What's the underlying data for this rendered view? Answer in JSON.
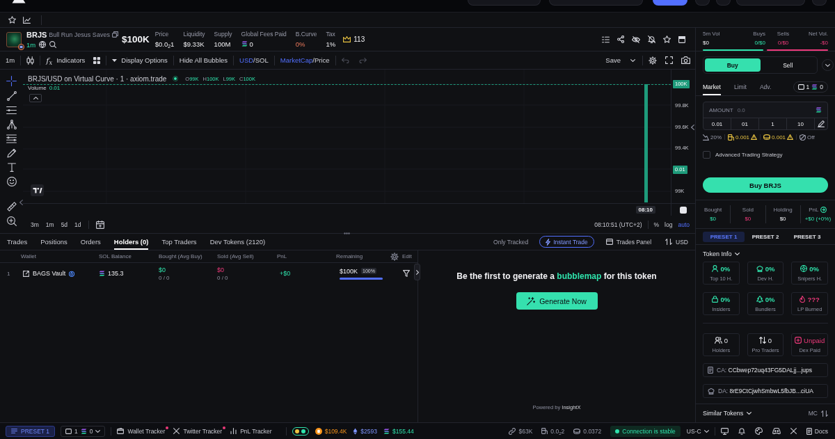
{
  "token": {
    "symbol": "BRJS",
    "name": "Bull Run Jesus Saves",
    "age": "1m",
    "market_cap": "$100K",
    "stats": [
      {
        "label": "Price",
        "value": "$0.0$_{2}$1",
        "kind": "plain"
      },
      {
        "label": "Liquidity",
        "value": "$9.33K",
        "kind": "plain"
      },
      {
        "label": "Supply",
        "value": "100M",
        "kind": "plain"
      },
      {
        "label": "Global Fees Paid",
        "value": "0",
        "kind": "sol"
      },
      {
        "label": "B.Curve",
        "value": "0%",
        "kind": "alert"
      },
      {
        "label": "Tax",
        "value": "1%",
        "kind": "plain"
      }
    ],
    "crown_count": "113"
  },
  "chart_toolbar": {
    "interval": "1m",
    "indicators": {
      "icon": "f$_{x}$",
      "label": "Indicators"
    },
    "display_options": "Display Options",
    "hide_bubbles": "Hide All Bubbles",
    "toggles": [
      {
        "options": [
          {
            "label": "USD",
            "selected": true
          },
          {
            "label": "SOL",
            "selected": false
          }
        ],
        "separator": "/"
      },
      {
        "options": [
          {
            "label": "MarketCap",
            "selected": true
          },
          {
            "label": "Price",
            "selected": false
          }
        ],
        "separator": "/"
      }
    ],
    "save": "Save"
  },
  "chart": {
    "title": "BRJS/USD on Virtual Curve · 1 · axiom.trade",
    "ohlc": [
      {
        "key": "O",
        "value": "99K"
      },
      {
        "key": "H",
        "value": "100K"
      },
      {
        "key": "L",
        "value": "99K"
      },
      {
        "key": "C",
        "value": "100K"
      }
    ],
    "volume": {
      "label": "Volume",
      "value": "0.01"
    },
    "axis_labels": [
      {
        "text": "100K",
        "kind": "marker"
      },
      {
        "text": "99.8K",
        "kind": "tick"
      },
      {
        "text": "99.6K",
        "kind": "tick"
      },
      {
        "text": "99.4K",
        "kind": "tick"
      },
      {
        "text": "0.01",
        "kind": "marker"
      },
      {
        "text": "99K",
        "kind": "tick"
      }
    ],
    "time_label": "08:10",
    "ranges": [
      "3m",
      "1m",
      "5d",
      "1d"
    ],
    "clock": "08:10:51 (UTC+2)",
    "scales": [
      {
        "label": "%",
        "selected": false
      },
      {
        "label": "log",
        "selected": false
      },
      {
        "label": "auto",
        "selected": true
      }
    ]
  },
  "bottom_panel": {
    "tabs": [
      {
        "label": "Trades",
        "selected": false
      },
      {
        "label": "Positions",
        "selected": false
      },
      {
        "label": "Orders",
        "selected": false
      },
      {
        "label": "Holders (0)",
        "selected": true
      },
      {
        "label": "Top Traders",
        "selected": false
      },
      {
        "label": "Dev Tokens (2120)",
        "selected": false
      }
    ],
    "only_tracked": "Only Tracked",
    "instant_trade": {
      "label": "Instant Trade",
      "on": true
    },
    "trades_panel": "Trades Panel",
    "currency": "USD",
    "holders": {
      "columns": [
        "Wallet",
        "SOL Balance",
        "Bought (Avg Buy)",
        "Sold (Avg Sell)",
        "PnL",
        "Remaining"
      ],
      "edit": "Edit",
      "rows": [
        {
          "rank": "1",
          "wallet": "BAGS Vault",
          "sol_balance": "135.3",
          "bought": "$0",
          "bought_count": "0 / 0",
          "sold": "$0",
          "sold_count": "0 / 0",
          "pnl": "+$0",
          "remaining": "$100K",
          "remaining_share": "100%",
          "level": 1
        }
      ]
    },
    "bubblemap": {
      "message": "Be the first to generate a **bubblemap** for this token",
      "button": "Generate Now",
      "powered_by": "Powered by",
      "provider": "InsightX"
    }
  },
  "side_panel": {
    "volume": [
      {
        "label": "5m Vol",
        "value": "$0",
        "kind": "neutral"
      },
      {
        "label": "Buys",
        "value": "0/$0",
        "kind": "buy"
      },
      {
        "label": "Sells",
        "value": "0/$0",
        "kind": "sell"
      },
      {
        "label": "Net Vol.",
        "value": "-$0",
        "kind": "sell"
      }
    ],
    "sides": [
      {
        "label": "Buy",
        "selected": true
      },
      {
        "label": "Sell",
        "selected": false
      }
    ],
    "order_types": [
      {
        "label": "Market",
        "selected": true
      },
      {
        "label": "Limit",
        "selected": false
      },
      {
        "label": "Adv.",
        "selected": false
      }
    ],
    "wallet_count": "1",
    "sol_balance": "0",
    "amount": {
      "label": "AMOUNT",
      "placeholder": "0.0"
    },
    "quick_amounts": [
      "0.01",
      "01",
      "1",
      "10"
    ],
    "settings": [
      {
        "value": "20%",
        "kind": "slippage",
        "warning": false
      },
      {
        "value": "0.001",
        "kind": "priority",
        "warning": true
      },
      {
        "value": "0.001",
        "kind": "tip",
        "warning": true
      },
      {
        "value": "Off",
        "kind": "protection",
        "warning": false
      }
    ],
    "advanced": {
      "label": "Advanced Trading Strategy",
      "checked": false
    },
    "buy_button": "Buy BRJS",
    "position": [
      {
        "label": "Bought",
        "value": "$0",
        "kind": "buy"
      },
      {
        "label": "Sold",
        "value": "$0",
        "kind": "sell"
      },
      {
        "label": "Holding",
        "value": "$0",
        "kind": "neutral"
      },
      {
        "label": "PnL",
        "value": "+$0 (+0%)",
        "kind": "pnl"
      }
    ],
    "presets": [
      {
        "label": "PRESET 1",
        "selected": true
      },
      {
        "label": "PRESET 2",
        "selected": false
      },
      {
        "label": "PRESET 3",
        "selected": false
      }
    ],
    "token_info": {
      "title": "Token Info",
      "risk_stats": [
        {
          "value": "0%",
          "label": "Top 10 H.",
          "color": "#2fe3ac"
        },
        {
          "value": "0%",
          "label": "Dev H.",
          "color": "#2fe3ac"
        },
        {
          "value": "0%",
          "label": "Snipers H.",
          "color": "#2fe3ac"
        },
        {
          "value": "0%",
          "label": "Insiders",
          "color": "#2fe3ac"
        },
        {
          "value": "0%",
          "label": "Bundlers",
          "color": "#2fe3ac"
        },
        {
          "value": "???",
          "label": "LP Burned",
          "color": "#ec397a"
        }
      ],
      "holder_stats": [
        {
          "value": "0",
          "label": "Holders",
          "kind": "neutral"
        },
        {
          "value": "0",
          "label": "Pro Traders",
          "kind": "neutral"
        },
        {
          "value": "Unpaid",
          "label": "Dex Paid",
          "kind": "alert"
        }
      ],
      "addresses": [
        {
          "label": "CA:",
          "value": "CCbwep72uq43FG5DALjj...jups"
        },
        {
          "label": "DA:",
          "value": "8rE9CtCjwhSmbwL5fbJB...ciUA"
        }
      ]
    },
    "similar_tokens": "Similar Tokens",
    "sort_label": "MC"
  },
  "footer": {
    "preset": "PRESET 1",
    "wallet_count": "1",
    "sol_balance": "0",
    "trackers": [
      {
        "label": "Wallet Tracker",
        "alert": true
      },
      {
        "label": "Twitter Tracker",
        "alert": true
      },
      {
        "label": "PnL Tracker",
        "alert": false
      }
    ],
    "quick_toggle": {
      "on": true
    },
    "prices": [
      {
        "value": "$109.4K",
        "kind": "btc"
      },
      {
        "value": "$2593",
        "kind": "eth"
      },
      {
        "value": "$155.44",
        "kind": "sol"
      }
    ],
    "metrics": [
      {
        "value": "$63K",
        "kind": "market_cap"
      },
      {
        "value": "0.0$_{2}$2",
        "kind": "fee"
      },
      {
        "value": "0.0372",
        "kind": "tip"
      }
    ],
    "connection": {
      "label": "Connection is stable",
      "stable": true
    },
    "region": "US-C",
    "docs": "Docs"
  }
}
